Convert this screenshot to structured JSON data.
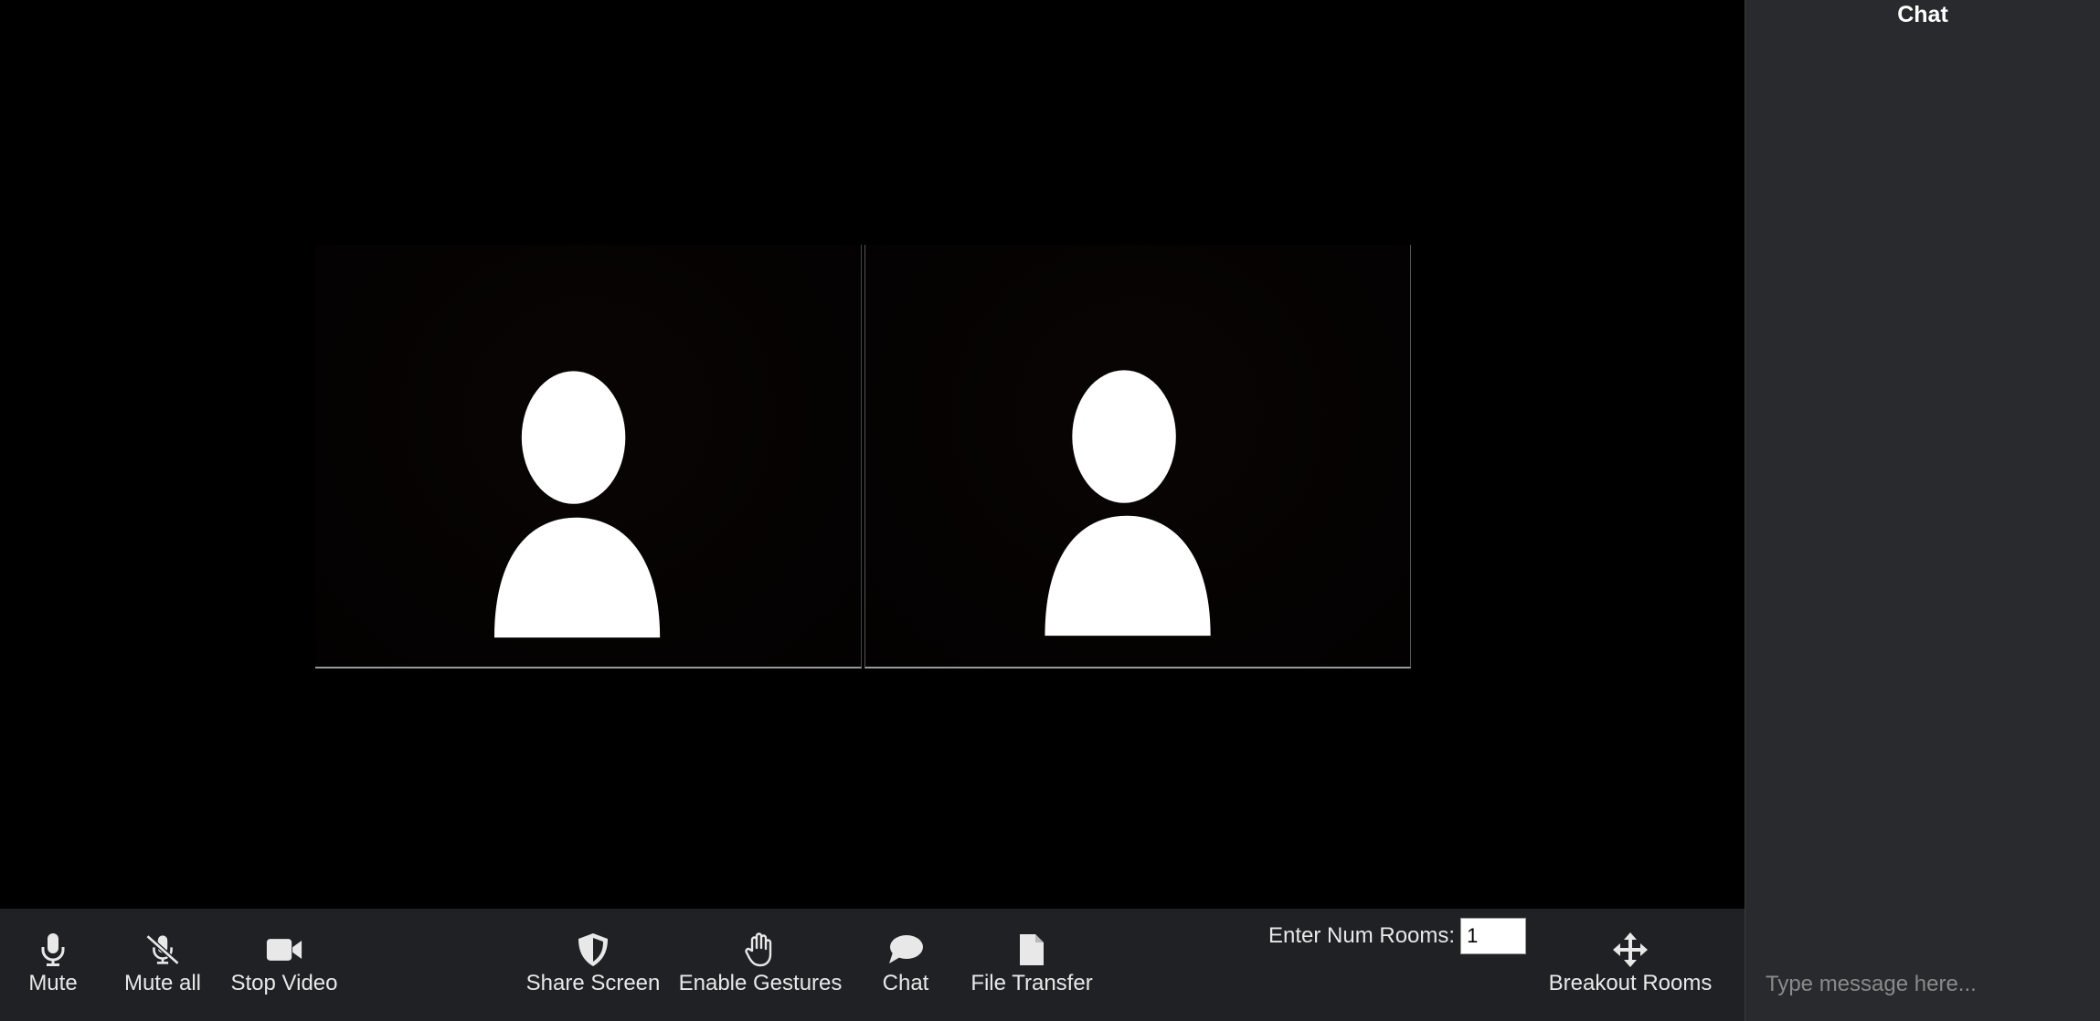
{
  "toolbar": {
    "mute_label": "Mute",
    "mute_all_label": "Mute all",
    "stop_video_label": "Stop Video",
    "share_screen_label": "Share Screen",
    "enable_gestures_label": "Enable Gestures",
    "chat_label": "Chat",
    "file_transfer_label": "File Transfer",
    "breakout_rooms_label": "Breakout Rooms",
    "num_rooms_label": "Enter Num Rooms:",
    "num_rooms_value": "1"
  },
  "chat": {
    "title": "Chat",
    "placeholder": "Type message here..."
  },
  "icons": {
    "mute": "microphone-icon",
    "mute_all": "microphone-slash-icon",
    "stop_video": "video-camera-icon",
    "share_screen": "shield-icon",
    "enable_gestures": "hand-icon",
    "chat": "speech-bubble-icon",
    "file_transfer": "file-icon",
    "breakout_rooms": "move-arrows-icon"
  },
  "colors": {
    "toolbar_bg": "#202124",
    "chat_bg": "#292a2d",
    "video_bg": "#000000"
  }
}
